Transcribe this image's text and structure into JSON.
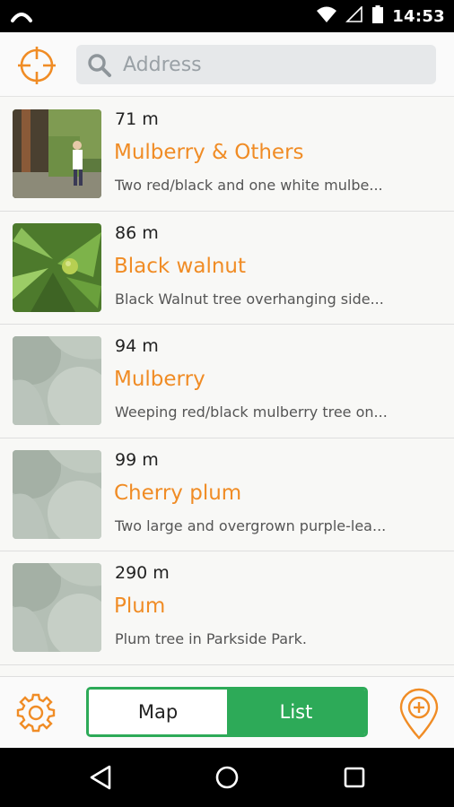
{
  "status_bar": {
    "time": "14:53"
  },
  "search": {
    "placeholder": "Address"
  },
  "listings": [
    {
      "distance": "71 m",
      "name": "Mulberry & Others",
      "description": "Two red/black and one white mulbe...",
      "thumb": "photo-person-tree"
    },
    {
      "distance": "86 m",
      "name": "Black walnut",
      "description": "Black Walnut tree overhanging side...",
      "thumb": "photo-walnut"
    },
    {
      "distance": "94 m",
      "name": "Mulberry",
      "description": "Weeping red/black mulberry tree on...",
      "thumb": "placeholder-fruit"
    },
    {
      "distance": "99 m",
      "name": "Cherry plum",
      "description": "Two large and overgrown purple-lea...",
      "thumb": "placeholder-fruit"
    },
    {
      "distance": "290 m",
      "name": "Plum",
      "description": "Plum tree in Parkside Park.",
      "thumb": "placeholder-fruit"
    }
  ],
  "view_toggle": {
    "map_label": "Map",
    "list_label": "List",
    "selected": "List"
  },
  "colors": {
    "accent_orange": "#f08c25",
    "accent_green": "#2daa58"
  },
  "icons": [
    "crosshair-icon",
    "search-icon",
    "gear-icon",
    "add-location-icon",
    "back-icon",
    "home-icon",
    "recents-icon"
  ]
}
